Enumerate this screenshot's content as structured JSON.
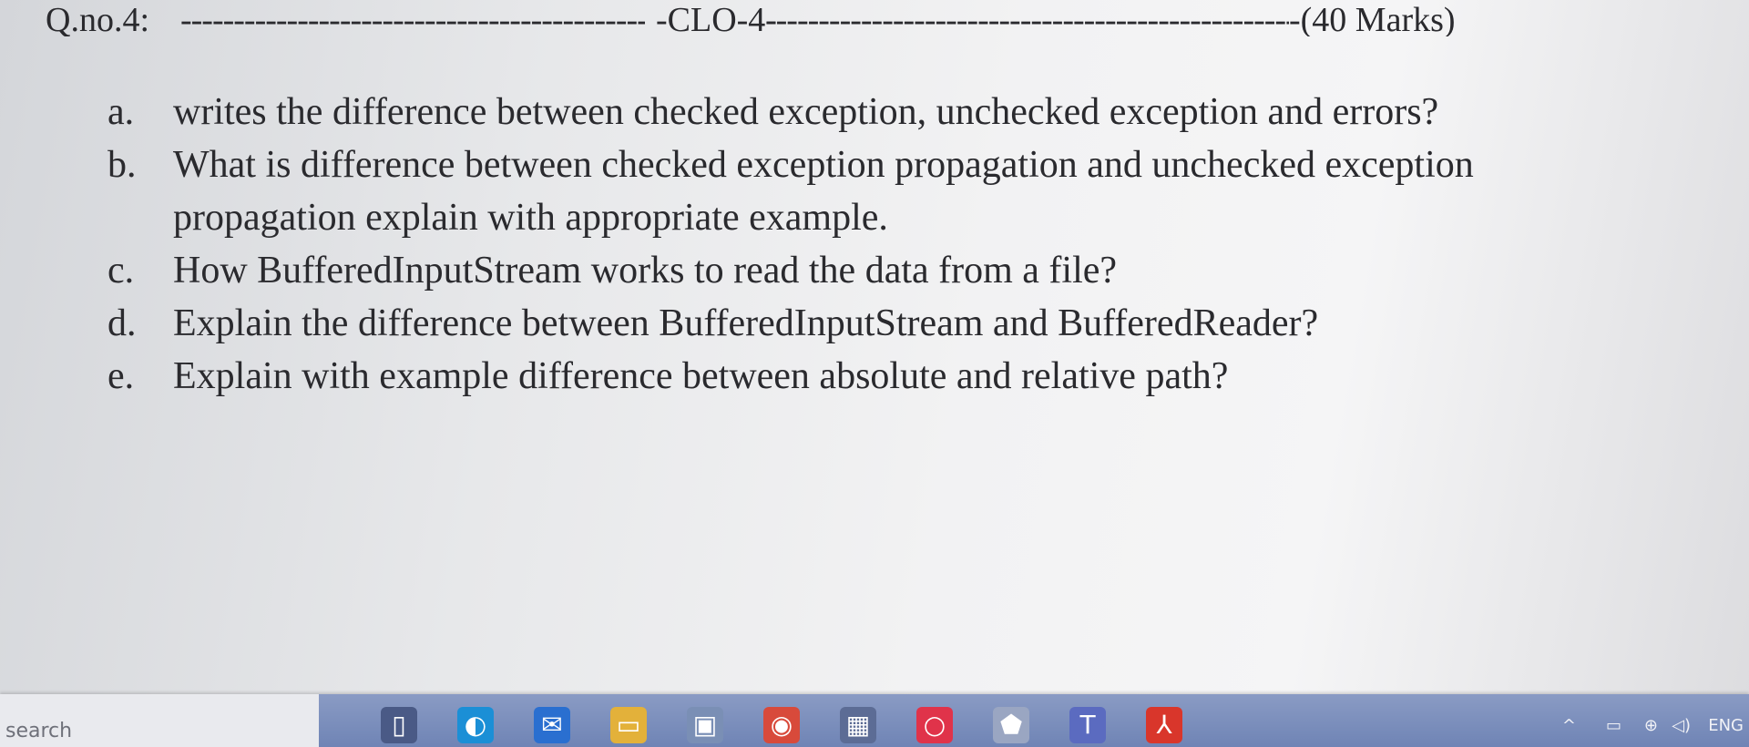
{
  "header": {
    "question_no": "Q.no.4:",
    "dashes_1": "------------------------------------------------",
    "clo": "-CLO-4-",
    "dashes_2": "--------------------------------------------------------",
    "marks": "-(40 Marks)"
  },
  "questions": [
    {
      "letter": "a.",
      "text": "writes the difference between checked exception, unchecked exception and errors?"
    },
    {
      "letter": "b.",
      "text": "What is difference between checked exception propagation and unchecked exception"
    },
    {
      "letter": "",
      "text": "propagation explain with appropriate example."
    },
    {
      "letter": "c.",
      "text": "How BufferedInputStream works to read the data from a file?"
    },
    {
      "letter": "d.",
      "text": "Explain the difference between BufferedInputStream and BufferedReader?"
    },
    {
      "letter": "e.",
      "text": "Explain with example difference between absolute and relative path?"
    }
  ],
  "taskbar": {
    "search_label": "search",
    "icons": [
      {
        "name": "task-view-icon",
        "glyph": "▯",
        "color": "#4a5a86"
      },
      {
        "name": "edge-icon",
        "glyph": "◐",
        "color": "#1b8fd6"
      },
      {
        "name": "mail-icon",
        "glyph": "✉",
        "color": "#2a6fd0"
      },
      {
        "name": "file-explorer-icon",
        "glyph": "▭",
        "color": "#e3b13a"
      },
      {
        "name": "store-icon",
        "glyph": "▣",
        "color": "#7a8fb5"
      },
      {
        "name": "chrome-icon",
        "glyph": "◉",
        "color": "#d84a3b"
      },
      {
        "name": "calculator-icon",
        "glyph": "▦",
        "color": "#5c6c95"
      },
      {
        "name": "opera-icon",
        "glyph": "○",
        "color": "#e0334a"
      },
      {
        "name": "app-icon",
        "glyph": "⬟",
        "color": "#9aa6c2"
      },
      {
        "name": "teams-icon",
        "glyph": "T",
        "color": "#5b6bc0"
      },
      {
        "name": "acrobat-icon",
        "glyph": "⅄",
        "color": "#d9362b"
      }
    ],
    "tray_lang": "ENG"
  }
}
